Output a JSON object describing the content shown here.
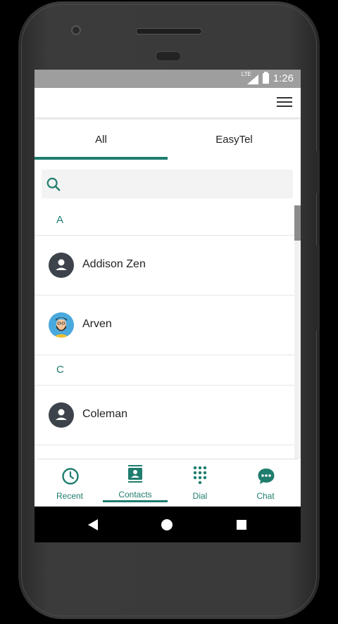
{
  "status": {
    "network": "LTE",
    "time": "1:26"
  },
  "tabs": [
    {
      "label": "All"
    },
    {
      "label": "EasyTel"
    }
  ],
  "search": {
    "placeholder": ""
  },
  "sections": [
    {
      "letter": "A",
      "contacts": [
        {
          "name": "Addison Zen",
          "avatar": "default-person"
        },
        {
          "name": "Arven",
          "avatar": "photo"
        }
      ]
    },
    {
      "letter": "C",
      "contacts": [
        {
          "name": "Coleman",
          "avatar": "default-person"
        }
      ]
    }
  ],
  "bottom_nav": [
    {
      "label": "Recent",
      "icon": "clock-icon"
    },
    {
      "label": "Contacts",
      "icon": "contacts-icon",
      "selected": true
    },
    {
      "label": "Dial",
      "icon": "dialpad-icon"
    },
    {
      "label": "Chat",
      "icon": "chat-icon"
    }
  ],
  "colors": {
    "accent": "#1f7d6e",
    "status_bar": "#9e9e9e"
  }
}
